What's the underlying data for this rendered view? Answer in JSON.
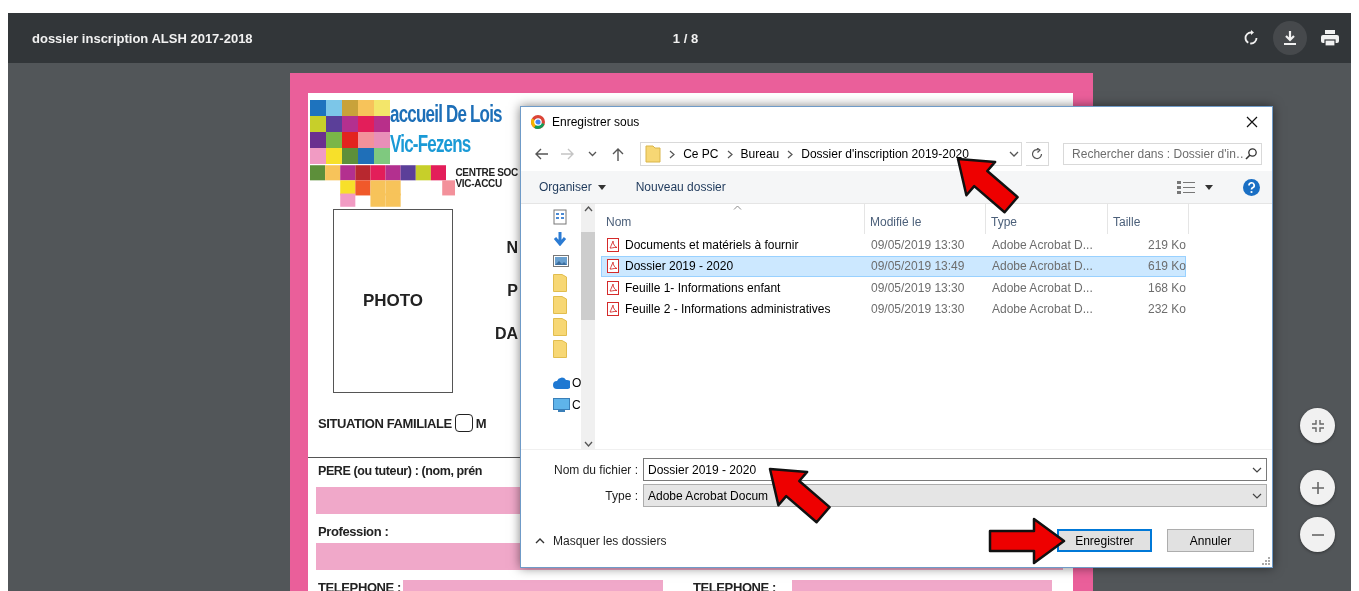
{
  "viewer": {
    "title": "dossier inscription ALSH 2017-2018",
    "page_indicator": "1 / 8"
  },
  "document": {
    "logo_title": [
      "accueil De Lois",
      "Vic-Fezens"
    ],
    "logo_subtitle": [
      "CENTRE SOC",
      "VIC-ACCU"
    ],
    "photo_label": "PHOTO",
    "identity_labels": [
      "N",
      "P",
      "DA"
    ],
    "family_situation": {
      "label": "SITUATION FAMILIALE",
      "option": {
        "label": "M",
        "checked": false
      }
    },
    "father_label": "PERE (ou tuteur) : (nom, prén",
    "profession_label": "Profession :",
    "phone_labels": [
      "TELEPHONE :",
      "TELEPHONE :"
    ]
  },
  "dialog": {
    "title": "Enregistrer sous",
    "nav_buttons": [
      {
        "kind": "back",
        "disabled": false
      },
      {
        "kind": "forward",
        "disabled": true
      },
      {
        "kind": "recent",
        "disabled": false
      },
      {
        "kind": "up",
        "disabled": false
      }
    ],
    "breadcrumb": [
      "Ce PC",
      "Bureau",
      "Dossier d'inscription 2019-2020"
    ],
    "search": {
      "placeholder": "Rechercher dans : Dossier d'in…"
    },
    "toolbar": [
      {
        "kind": "menu",
        "label": "Organiser"
      },
      {
        "kind": "button",
        "label": "Nouveau dossier"
      }
    ],
    "nav_pane": [
      {
        "kind": "document"
      },
      {
        "kind": "download"
      },
      {
        "kind": "picture"
      },
      {
        "kind": "folder"
      },
      {
        "kind": "folder"
      },
      {
        "kind": "folder"
      },
      {
        "kind": "folder"
      },
      {
        "kind": "cloud",
        "label": "O"
      },
      {
        "kind": "computer",
        "label": "C"
      }
    ],
    "columns": [
      {
        "label": "Nom",
        "sorted": true
      },
      {
        "label": "Modifié le",
        "sorted": false
      },
      {
        "label": "Type",
        "sorted": false
      },
      {
        "label": "Taille",
        "sorted": false
      }
    ],
    "files": [
      {
        "name": "Documents et matériels à fournir",
        "modified": "09/05/2019 13:30",
        "type": "Adobe Acrobat D...",
        "size": "219 Ko",
        "selected": false
      },
      {
        "name": "Dossier 2019 - 2020",
        "modified": "09/05/2019 13:49",
        "type": "Adobe Acrobat D...",
        "size": "619 Ko",
        "selected": true
      },
      {
        "name": "Feuille 1- Informations enfant",
        "modified": "09/05/2019 13:30",
        "type": "Adobe Acrobat D...",
        "size": "168 Ko",
        "selected": false
      },
      {
        "name": "Feuille 2 - Informations administratives",
        "modified": "09/05/2019 13:30",
        "type": "Adobe Acrobat D...",
        "size": "232 Ko",
        "selected": false
      }
    ],
    "filename": {
      "label": "Nom du fichier :",
      "value": "Dossier 2019 - 2020"
    },
    "filetype": {
      "label": "Type :",
      "value": "Adobe Acrobat Docum"
    },
    "folders_toggle": {
      "label": "Masquer les dossiers",
      "expanded": true
    },
    "buttons": [
      {
        "label": "Enregistrer",
        "default": true
      },
      {
        "label": "Annuler",
        "default": false
      }
    ]
  }
}
